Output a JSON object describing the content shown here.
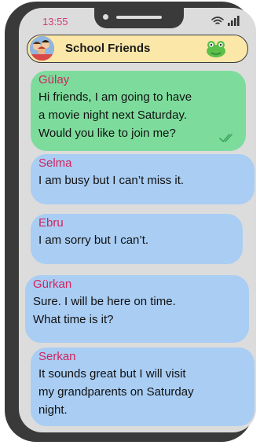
{
  "status_bar": {
    "time": "13:55",
    "icons": [
      "wifi-icon",
      "signal-icon"
    ]
  },
  "header": {
    "title": "School Friends",
    "avatar_icon": "group-photo-avatar",
    "sticker_icon": "frog-icon"
  },
  "messages": [
    {
      "sender": "Gülay",
      "text": "Hi friends, I am going to have\na movie night next Saturday.\nWould you like to join me?",
      "outgoing": true,
      "read_icon": "double-check-icon"
    },
    {
      "sender": "Selma",
      "text": "I am busy but I can’t miss it.",
      "outgoing": false
    },
    {
      "sender": "Ebru",
      "text": "I am sorry but I can’t.",
      "outgoing": false
    },
    {
      "sender": "Gürkan",
      "text": "Sure. I will be here on time.\nWhat time is it?",
      "outgoing": false
    },
    {
      "sender": "Serkan",
      "text": "It sounds great but I will visit\nmy grandparents on Saturday\nnight.",
      "outgoing": false
    }
  ],
  "colors": {
    "outgoing_bubble": "#7ddc9c",
    "incoming_bubble": "#a9cdf3",
    "sender_name": "#d0245f",
    "header_bg": "#fbe7a8",
    "screen_bg": "#dcdcdc"
  }
}
